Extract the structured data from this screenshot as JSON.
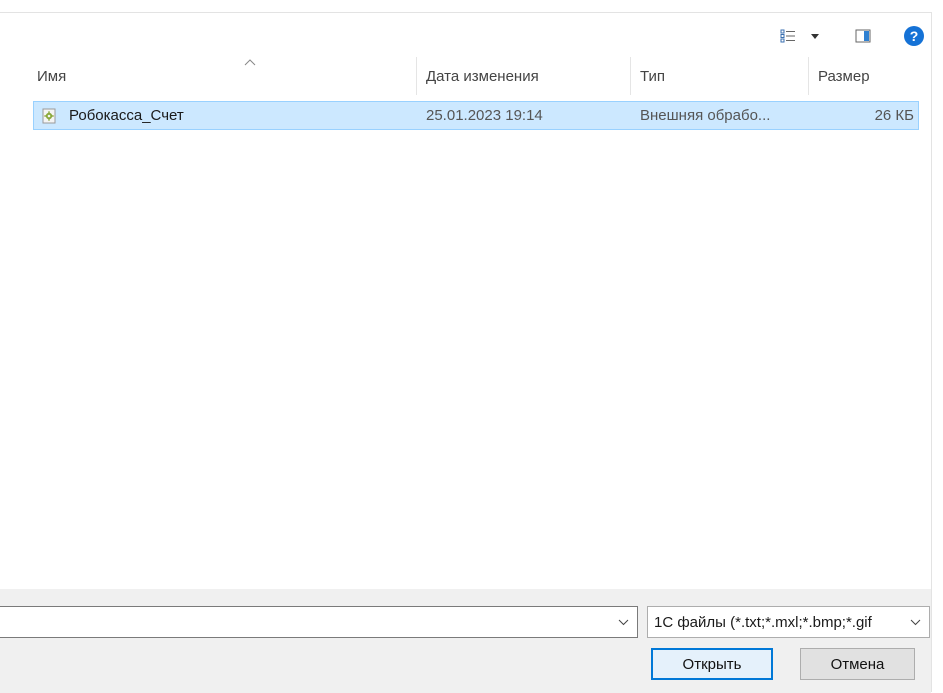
{
  "toolbar": {
    "view_icon": "details-view-icon",
    "preview_icon": "preview-pane-icon",
    "help_label": "?"
  },
  "columns": [
    {
      "key": "name",
      "label": "Имя"
    },
    {
      "key": "date",
      "label": "Дата изменения"
    },
    {
      "key": "type",
      "label": "Тип"
    },
    {
      "key": "size",
      "label": "Размер"
    }
  ],
  "files": [
    {
      "name": "Робокасса_Счет",
      "date": "25.01.2023 19:14",
      "type": "Внешняя обрабо...",
      "size": "26 КБ",
      "selected": true
    }
  ],
  "footer": {
    "file_name_value": "",
    "filter_value": "1С файлы (*.txt;*.mxl;*.bmp;*.gif",
    "open_label": "Открыть",
    "cancel_label": "Отмена"
  },
  "colors": {
    "selection_bg": "#cce8ff",
    "selection_border": "#99d1ff",
    "accent": "#0078d7",
    "help": "#1572d6"
  }
}
